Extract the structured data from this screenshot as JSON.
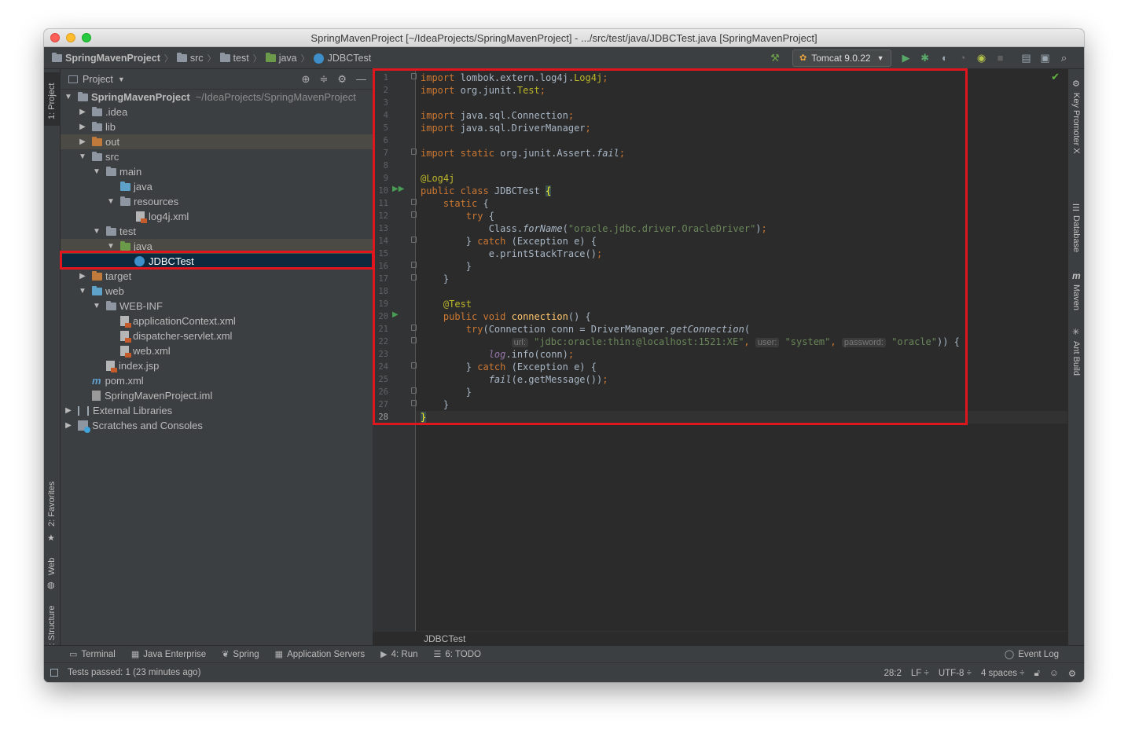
{
  "window": {
    "title": "SpringMavenProject [~/IdeaProjects/SpringMavenProject] - .../src/test/java/JDBCTest.java [SpringMavenProject]"
  },
  "navbar": {
    "breadcrumbs": [
      "SpringMavenProject",
      "src",
      "test",
      "java",
      "JDBCTest"
    ],
    "run_config": "Tomcat 9.0.22"
  },
  "left_strip": {
    "tabs": [
      "1: Project",
      "2: Favorites",
      "Web",
      "Z: Structure"
    ]
  },
  "right_strip": {
    "tabs": [
      "Key Promoter X",
      "Database",
      "Maven",
      "Ant Build"
    ]
  },
  "project_panel": {
    "title": "Project",
    "tree": [
      {
        "label": "SpringMavenProject",
        "extra": "~/IdeaProjects/SpringMavenProject"
      },
      {
        "label": ".idea"
      },
      {
        "label": "lib"
      },
      {
        "label": "out"
      },
      {
        "label": "src"
      },
      {
        "label": "main"
      },
      {
        "label": "java"
      },
      {
        "label": "resources"
      },
      {
        "label": "log4j.xml"
      },
      {
        "label": "test"
      },
      {
        "label": "java"
      },
      {
        "label": "JDBCTest"
      },
      {
        "label": "target"
      },
      {
        "label": "web"
      },
      {
        "label": "WEB-INF"
      },
      {
        "label": "applicationContext.xml"
      },
      {
        "label": "dispatcher-servlet.xml"
      },
      {
        "label": "web.xml"
      },
      {
        "label": "index.jsp"
      },
      {
        "label": "pom.xml"
      },
      {
        "label": "SpringMavenProject.iml"
      },
      {
        "label": "External Libraries"
      },
      {
        "label": "Scratches and Consoles"
      }
    ]
  },
  "editor": {
    "line_numbers": [
      "1",
      "2",
      "3",
      "4",
      "5",
      "6",
      "7",
      "8",
      "9",
      "10",
      "11",
      "12",
      "13",
      "14",
      "15",
      "16",
      "17",
      "18",
      "19",
      "20",
      "21",
      "22",
      "23",
      "24",
      "25",
      "26",
      "27",
      "28"
    ],
    "code": {
      "l1_kw": "import",
      "l1_pkg": " lombok.extern.log4j.",
      "l1_cls": "Log4j",
      "l1_end": ";",
      "l2_kw": "import",
      "l2_pkg": " org.junit.",
      "l2_cls": "Test",
      "l2_end": ";",
      "l4_kw": "import",
      "l4_rest": " java.sql.Connection",
      "l4_end": ";",
      "l5_kw": "import",
      "l5_rest": " java.sql.DriverManager",
      "l5_end": ";",
      "l7_kw": "import static",
      "l7_rest": " org.junit.Assert.",
      "l7_m": "fail",
      "l7_end": ";",
      "l9_an": "@Log4j",
      "l10_kw": "public class",
      "l10_name": " JDBCTest ",
      "l10_br": "{",
      "l11_kw": "static",
      "l11_rest": " {",
      "l12_kw": "try",
      "l12_rest": " {",
      "l13_a": "Class.",
      "l13_m": "forName",
      "l13_b": "(",
      "l13_s": "\"oracle.jdbc.driver.OracleDriver\"",
      "l13_c": ")",
      "l13_end": ";",
      "l14_a": "} ",
      "l14_kw": "catch",
      "l14_rest": " (Exception e) {",
      "l15_a": "e.printStackTrace()",
      "l15_end": ";",
      "l16": "}",
      "l17": "}",
      "l19_an": "@Test",
      "l20_kw": "public void",
      "l20_m": " connection",
      "l20_rest": "() {",
      "l21_kw": "try",
      "l21_a": "(Connection conn = DriverManager.",
      "l21_m": "getConnection",
      "l21_b": "(",
      "l22_h1": "url:",
      "l22_s1": "\"jdbc:oracle:thin:@localhost:1521:XE\"",
      "l22_h2": "user:",
      "l22_s2": "\"system\"",
      "l22_h3": "password:",
      "l22_s3": "\"oracle\"",
      "l22_end": ")) {",
      "l23_log": "log",
      "l23_rest": ".info(conn)",
      "l23_end": ";",
      "l24_a": "} ",
      "l24_kw": "catch",
      "l24_rest": " (Exception e) {",
      "l25_m": "fail",
      "l25_rest": "(e.getMessage())",
      "l25_end": ";",
      "l26": "}",
      "l27": "}",
      "l28": "}"
    },
    "file_breadcrumb": "JDBCTest"
  },
  "tool_tabs": [
    {
      "label": "Terminal",
      "icon": "terminal-icon"
    },
    {
      "label": "Java Enterprise",
      "icon": "java-enterprise-icon"
    },
    {
      "label": "Spring",
      "icon": "spring-icon"
    },
    {
      "label": "Application Servers",
      "icon": "app-servers-icon"
    },
    {
      "label": "4: Run",
      "icon": "run-icon"
    },
    {
      "label": "6: TODO",
      "icon": "todo-icon"
    },
    {
      "label": "Event Log",
      "icon": "event-log-icon"
    }
  ],
  "status_bar": {
    "message": "Tests passed: 1 (23 minutes ago)",
    "position": "28:2",
    "line_sep": "LF ÷",
    "encoding": "UTF-8 ÷",
    "indent": "4 spaces ÷"
  },
  "colors": {
    "highlight_box": "#e0161e",
    "editor_bg": "#2b2b2b",
    "panel_bg": "#3c3f41",
    "selection": "#0d293e"
  }
}
